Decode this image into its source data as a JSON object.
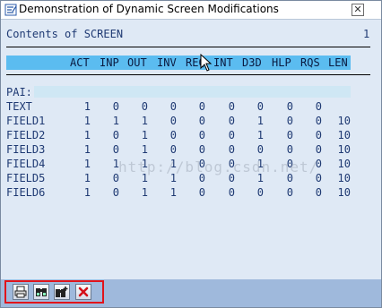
{
  "window": {
    "title": "Demonstration of Dynamic Screen Modifications",
    "close_symbol": "✕"
  },
  "content": {
    "heading": "Contents of SCREEN",
    "page_number": "1",
    "columns": [
      "ACT",
      "INP",
      "OUT",
      "INV",
      "REQ",
      "INT",
      "D3D",
      "HLP",
      "RQS",
      "LEN"
    ],
    "pai_label": "PAI:",
    "rows": [
      {
        "name": "TEXT",
        "values": [
          "1",
          "0",
          "0",
          "0",
          "0",
          "0",
          "0",
          "0",
          "0",
          ""
        ]
      },
      {
        "name": "FIELD1",
        "values": [
          "1",
          "1",
          "1",
          "0",
          "0",
          "0",
          "1",
          "0",
          "0",
          "10"
        ]
      },
      {
        "name": "FIELD2",
        "values": [
          "1",
          "0",
          "1",
          "0",
          "0",
          "0",
          "1",
          "0",
          "0",
          "10"
        ]
      },
      {
        "name": "FIELD3",
        "values": [
          "1",
          "0",
          "1",
          "0",
          "0",
          "0",
          "0",
          "0",
          "0",
          "10"
        ]
      },
      {
        "name": "FIELD4",
        "values": [
          "1",
          "1",
          "1",
          "1",
          "0",
          "0",
          "1",
          "0",
          "0",
          "10"
        ]
      },
      {
        "name": "FIELD5",
        "values": [
          "1",
          "0",
          "1",
          "1",
          "0",
          "0",
          "1",
          "0",
          "0",
          "10"
        ]
      },
      {
        "name": "FIELD6",
        "values": [
          "1",
          "0",
          "1",
          "1",
          "0",
          "0",
          "0",
          "0",
          "0",
          "10"
        ]
      }
    ],
    "watermark": "http://blog.csdn.net/"
  },
  "colors": {
    "accent": "#5bbcf0",
    "toolbar": "#9fb9dc",
    "highlight_frame": "#e1141b",
    "text": "#1f3a73"
  },
  "toolbar": {
    "buttons": [
      {
        "name": "print-button",
        "icon": "print-icon"
      },
      {
        "name": "find-button",
        "icon": "binoculars-icon"
      },
      {
        "name": "find-next-button",
        "icon": "binoculars-plus-icon"
      },
      {
        "name": "cancel-button",
        "icon": "cancel-x-icon"
      }
    ]
  }
}
